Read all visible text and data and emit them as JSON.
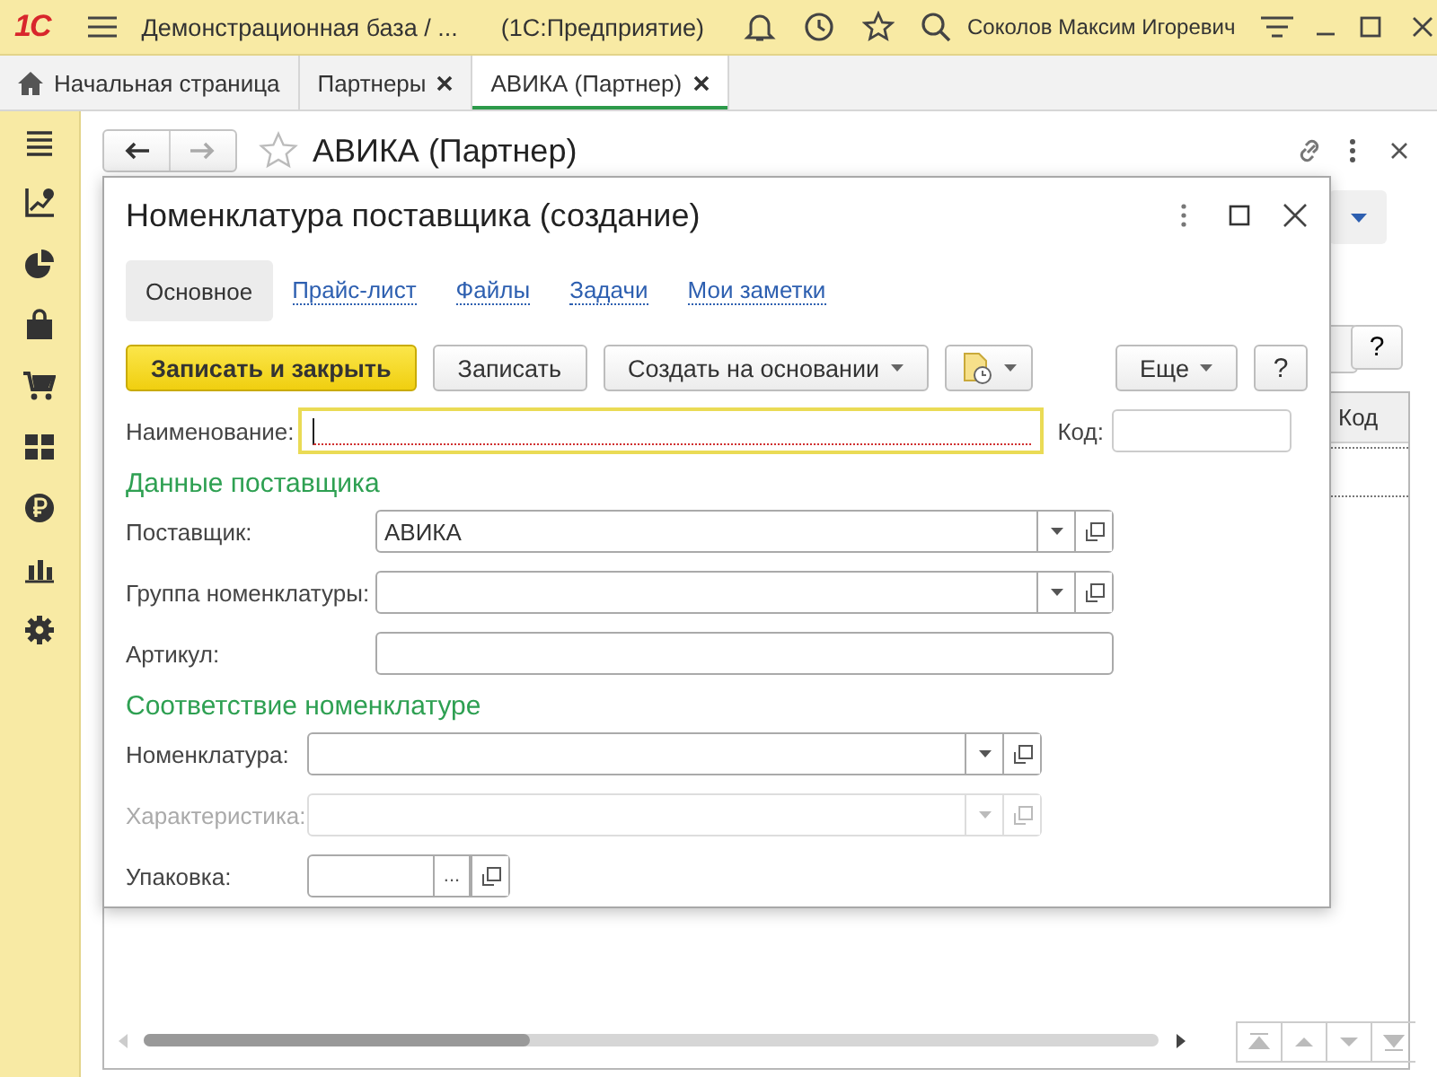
{
  "app_bar": {
    "logo": "1С",
    "title": "Демонстрационная база / ...",
    "subtitle": "(1С:Предприятие)",
    "user": "Соколов Максим Игоревич"
  },
  "tabs": [
    {
      "label": "Начальная страница",
      "kind": "home",
      "selected": false
    },
    {
      "label": "Партнеры",
      "kind": "closable",
      "selected": false
    },
    {
      "label": "АВИКА (Партнер)",
      "kind": "closable",
      "selected": true
    }
  ],
  "background_form": {
    "title": "АВИКА (Партнер)",
    "help_button": "?",
    "table_columns": [
      "Код"
    ]
  },
  "dialog": {
    "title": "Номенклатура поставщика (создание)",
    "tabs": [
      {
        "label": "Основное",
        "selected": true
      },
      {
        "label": "Прайс-лист",
        "selected": false
      },
      {
        "label": "Файлы",
        "selected": false
      },
      {
        "label": "Задачи",
        "selected": false
      },
      {
        "label": "Мои заметки",
        "selected": false
      }
    ],
    "toolbar": [
      {
        "kind": "primary",
        "label": "Записать и закрыть"
      },
      {
        "kind": "plain",
        "label": "Записать"
      },
      {
        "kind": "menu",
        "label": "Создать на основании"
      },
      {
        "kind": "report"
      }
    ],
    "toolbar_right": [
      {
        "kind": "menu",
        "label": "Еще"
      },
      {
        "kind": "plain",
        "label": "?"
      }
    ],
    "name_field": {
      "label": "Наименование:",
      "focused": true,
      "required": true
    },
    "code_field": {
      "label": "Код:"
    },
    "sections": [
      {
        "title": "Данные поставщика",
        "fields": [
          {
            "label": "Поставщик:",
            "kind": "input",
            "value": "АВИКА",
            "disabled": false,
            "buttons": [
              {
                "kind": "dropdown"
              },
              {
                "kind": "open"
              }
            ]
          },
          {
            "label": "Группа номенклатуры:",
            "kind": "input",
            "disabled": false,
            "buttons": [
              {
                "kind": "dropdown"
              },
              {
                "kind": "open"
              }
            ]
          },
          {
            "label": "Артикул:",
            "kind": "input",
            "disabled": false
          }
        ]
      },
      {
        "title": "Соответствие номенклатуре",
        "fields": [
          {
            "label": "Номенклатура:",
            "kind": "input",
            "disabled": false,
            "buttons": [
              {
                "kind": "dropdown"
              },
              {
                "kind": "open"
              }
            ]
          },
          {
            "label": "Характеристика:",
            "kind": "input",
            "disabled": true,
            "buttons": [
              {
                "kind": "dropdown"
              },
              {
                "kind": "open"
              }
            ]
          },
          {
            "label": "Упаковка:",
            "kind": "compact",
            "disabled": false,
            "buttons": [
              {
                "kind": "select",
                "label": "..."
              },
              {
                "kind": "open"
              }
            ]
          }
        ]
      }
    ]
  }
}
